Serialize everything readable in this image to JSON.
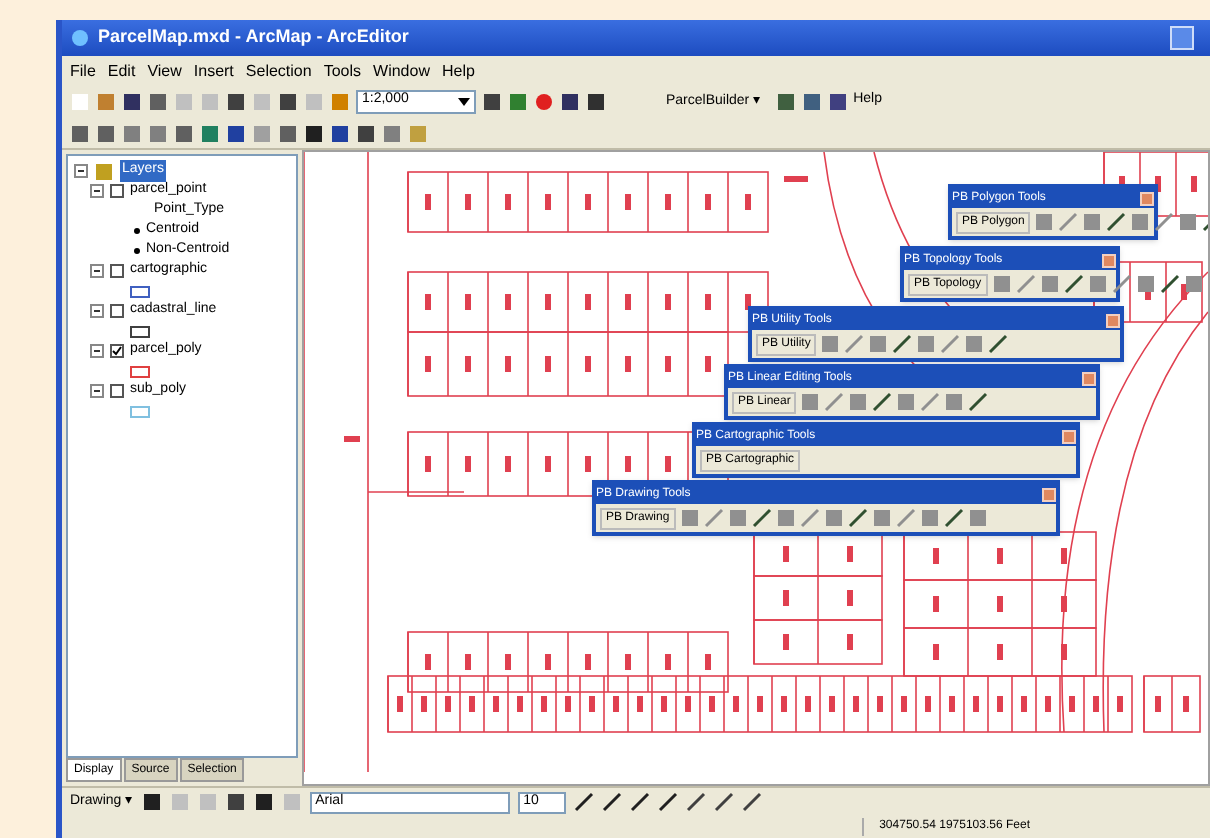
{
  "window": {
    "title": "ParcelMap.mxd - ArcMap - ArcEditor"
  },
  "menu": [
    "File",
    "Edit",
    "View",
    "Insert",
    "Selection",
    "Tools",
    "Window",
    "Help"
  ],
  "standard_toolbar": {
    "scale": "1:2,000",
    "parcel_builder": "ParcelBuilder ▾",
    "help_label": "Help"
  },
  "toc": {
    "root": {
      "label": "Layers",
      "selected": true,
      "expanded": true,
      "children": [
        {
          "label": "parcel_point",
          "checked": false,
          "expanded": true,
          "children": [
            {
              "kind": "heading",
              "label": "Point_Type"
            },
            {
              "kind": "symbol",
              "label": "Centroid"
            },
            {
              "kind": "symbol",
              "label": "Non-Centroid"
            }
          ]
        },
        {
          "label": "cartographic",
          "checked": false,
          "expanded": true,
          "color": "#4060c0"
        },
        {
          "label": "cadastral_line",
          "checked": false,
          "expanded": true,
          "color": "#404040"
        },
        {
          "label": "parcel_poly",
          "checked": true,
          "expanded": true,
          "color": "#e04040"
        },
        {
          "label": "sub_poly",
          "checked": false,
          "expanded": true,
          "color": "#80c0e0"
        }
      ]
    },
    "tabs": [
      {
        "label": "Display",
        "selected": true
      },
      {
        "label": "Source",
        "selected": false
      },
      {
        "label": "Selection",
        "selected": false
      }
    ]
  },
  "floating_toolbars": [
    {
      "title": "PB Polygon Tools",
      "label": "PB Polygon"
    },
    {
      "title": "PB Topology Tools",
      "label": "PB Topology"
    },
    {
      "title": "PB Utility Tools",
      "label": "PB Utility"
    },
    {
      "title": "PB Linear Editing Tools",
      "label": "PB Linear"
    },
    {
      "title": "PB Cartographic Tools",
      "label": "PB Cartographic"
    },
    {
      "title": "PB Drawing Tools",
      "label": "PB Drawing"
    }
  ],
  "drawing_toolbar": {
    "menu": "Drawing ▾",
    "font": "Arial",
    "size": "10"
  },
  "status_bar": {
    "coordinates": "304750.54  1975103.56 Feet"
  }
}
